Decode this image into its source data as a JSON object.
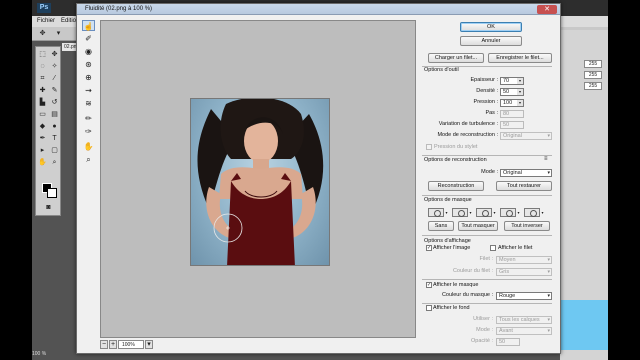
{
  "photoshop": {
    "logo": "Ps",
    "menu": [
      "Fichier",
      "Editio"
    ],
    "document_tab": "02.png",
    "status_zoom": "100 %",
    "right_panel_values": [
      "255",
      "255",
      "255"
    ]
  },
  "dialog": {
    "title": "Fluidité (02.png à 100 %)",
    "close_glyph": "✕",
    "zoom_value": "100%",
    "zoom_minus": "−",
    "zoom_plus": "+",
    "buttons": {
      "ok": "OK",
      "cancel": "Annuler",
      "load_mesh": "Charger un filet...",
      "save_mesh": "Enregistrer le filet..."
    },
    "tool_options": {
      "heading": "Options d'outil",
      "brush_size": {
        "label": "Epaisseur :",
        "value": "70"
      },
      "brush_density": {
        "label": "Densité :",
        "value": "50"
      },
      "brush_pressure": {
        "label": "Pression :",
        "value": "100"
      },
      "brush_rate": {
        "label": "Pas :",
        "value": "80"
      },
      "turbulent_jitter": {
        "label": "Variation de turbulence :",
        "value": "50"
      },
      "reconstruct_mode": {
        "label": "Mode de reconstruction :",
        "value": "Original"
      },
      "stylus_pressure": "Pression du stylet"
    },
    "reconstruct_options": {
      "heading": "Options de reconstruction",
      "mode": {
        "label": "Mode :",
        "value": "Original"
      },
      "reconstruct_button": "Reconstruction",
      "restore_all_button": "Tout restaurer"
    },
    "mask_options": {
      "heading": "Options de masque",
      "none_button": "Sans",
      "mask_all_button": "Tout masquer",
      "invert_all_button": "Tout inverser"
    },
    "view_options": {
      "heading": "Options d'affichage",
      "show_image": "Afficher l'image",
      "show_mesh": "Afficher le filet",
      "mesh_size": {
        "label": "Filet :",
        "value": "Moyen"
      },
      "mesh_color": {
        "label": "Couleur du filet :",
        "value": "Gris"
      },
      "show_mask": "Afficher le masque",
      "mask_color": {
        "label": "Couleur du masque :",
        "value": "Rouge"
      },
      "show_backdrop": "Afficher le fond",
      "use": {
        "label": "Utiliser :",
        "value": "Tous les calques"
      },
      "mode": {
        "label": "Mode :",
        "value": "Avant"
      },
      "opacity": {
        "label": "Opacité :",
        "value": "50"
      }
    }
  },
  "colors": {
    "mask_red": "#8a0f12",
    "dialog_bg": "#f0f0f0",
    "canvas_gray": "#bdbdbd"
  }
}
